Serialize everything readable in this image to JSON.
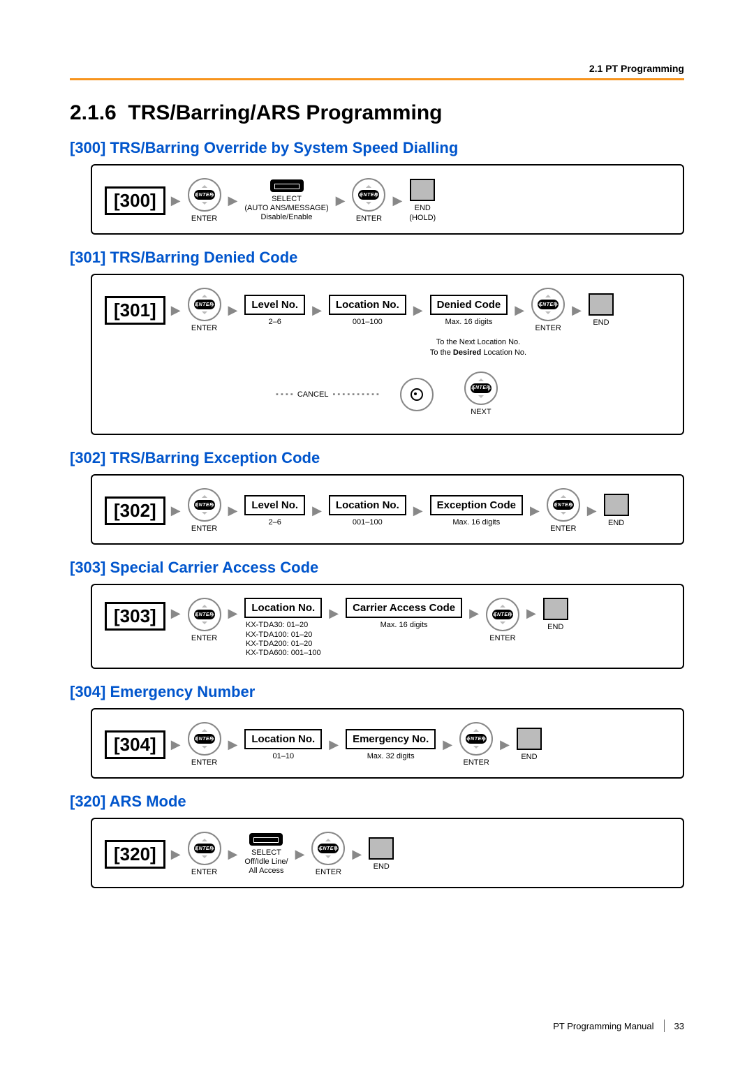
{
  "header": {
    "section_label": "2.1 PT Programming"
  },
  "main": {
    "number": "2.1.6",
    "title": "TRS/Barring/ARS Programming"
  },
  "items": {
    "i300": {
      "heading": "[300] TRS/Barring Override by System Speed Dialling",
      "code": "[300]",
      "select_caption_top": "SELECT",
      "select_caption_mid": "(AUTO ANS/MESSAGE)",
      "select_caption_bot": "Disable/Enable",
      "enter": "ENTER",
      "end": "END",
      "hold": "(HOLD)"
    },
    "i301": {
      "heading": "[301] TRS/Barring Denied Code",
      "code": "[301]",
      "level": "Level No.",
      "level_range": "2–6",
      "location": "Location No.",
      "location_range": "001–100",
      "denied": "Denied Code",
      "denied_range": "Max. 16 digits",
      "enter": "ENTER",
      "end": "END",
      "to_next": "To the Next Location No.",
      "to_desired": "To the Desired Location No.",
      "cancel": "CANCEL",
      "next": "NEXT"
    },
    "i302": {
      "heading": "[302] TRS/Barring Exception Code",
      "code": "[302]",
      "level": "Level No.",
      "level_range": "2–6",
      "location": "Location No.",
      "location_range": "001–100",
      "exc": "Exception Code",
      "exc_range": "Max. 16 digits",
      "enter": "ENTER",
      "end": "END"
    },
    "i303": {
      "heading": "[303] Special Carrier Access Code",
      "code": "[303]",
      "location": "Location No.",
      "loc_ranges": [
        "KX-TDA30: 01–20",
        "KX-TDA100: 01–20",
        "KX-TDA200: 01–20",
        "KX-TDA600: 001–100"
      ],
      "carrier": "Carrier Access Code",
      "carrier_range": "Max. 16 digits",
      "enter": "ENTER",
      "end": "END"
    },
    "i304": {
      "heading": "[304] Emergency Number",
      "code": "[304]",
      "location": "Location No.",
      "location_range": "01–10",
      "emergency": "Emergency No.",
      "emergency_range": "Max. 32 digits",
      "enter": "ENTER",
      "end": "END"
    },
    "i320": {
      "heading": "[320] ARS Mode",
      "code": "[320]",
      "select_caption_top": "SELECT",
      "select_caption_mid": "Off/Idle Line/",
      "select_caption_bot": "All Access",
      "enter": "ENTER",
      "end": "END"
    }
  },
  "footer": {
    "manual": "PT Programming Manual",
    "page": "33"
  }
}
